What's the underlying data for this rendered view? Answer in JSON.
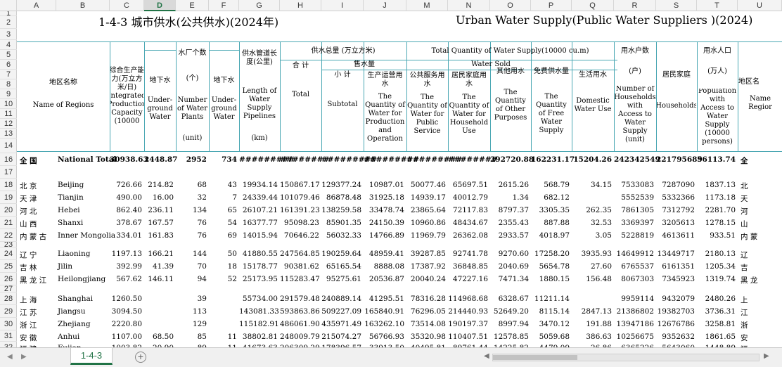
{
  "titles": {
    "cn": "1-4-3   城市供水(公共供水)(2024年)",
    "en": "Urban Water Supply(Public Water Suppliers )(2024)"
  },
  "columns": [
    "A",
    "B",
    "C",
    "D",
    "E",
    "F",
    "G",
    "H",
    "I",
    "J",
    "M",
    "N",
    "O",
    "P",
    "Q",
    "R",
    "S",
    "T",
    "U"
  ],
  "selected_column": "D",
  "rows": [
    "1",
    "2",
    "3",
    "4",
    "5",
    "6",
    "7",
    "8",
    "9",
    "10",
    "11",
    "12",
    "13",
    "14",
    "16",
    "17",
    "18",
    "19",
    "20",
    "21",
    "22",
    "23",
    "24",
    "25",
    "26",
    "27",
    "28",
    "29",
    "30",
    "31",
    "32"
  ],
  "headers": {
    "region_cn": "地区名称",
    "region_en": "Name of Regions",
    "capacity": "综合生产能力(万立方米/日) Integrated Production Capacity (10000",
    "underground_cn": "地下水",
    "underground_en": "Under-ground Water",
    "plants_cn": "水厂个数",
    "plants_unit": "(个)",
    "plants_en": "Number of Water Plants",
    "plants_unit_en": "(unit)",
    "plants_ug_cn": "地下水",
    "plants_ug_en": "Under-ground Water",
    "pipeline_cn": "供水管道长度(公里)",
    "pipeline_en": "Length of Water Supply Pipelines",
    "pipeline_unit": "(km)",
    "total_group_cn": "供水总量 (万立方米)",
    "total_group_en": "Total Quantity of Water Supply(10000 cu.m)",
    "total_cn": "合 计",
    "total_en": "Total",
    "sold_cn": "售水量",
    "sold_en": "Water Sold",
    "subtotal_cn": "小 计",
    "subtotal_en": "Subtotal",
    "production_cn": "生产运营用水",
    "production_en": "The Quantity of Water for Production and Operation",
    "public_cn": "公共服务用水",
    "public_en": "The Quantity of Water for Public Service",
    "household_cn": "居民家庭用水",
    "household_en": "The Quantity of Water for Household Use",
    "other_cn": "其他用水",
    "other_en": "The Quantity of Other Purposes",
    "free_cn": "免费供水量",
    "free_en": "The Quantity of Free Water Supply",
    "domestic_cn": "生活用水",
    "domestic_en": "Domestic Water Use",
    "hh_count_cn": "用水户数",
    "hh_count_unit": "(户)",
    "hh_count_en": "Number of Households with Access to Water Supply",
    "hh_count_unit_en": "(unit)",
    "resident_cn": "居民家庭",
    "resident_en": "Households",
    "pop_cn": "用水人口",
    "pop_unit": "(万人)",
    "pop_en": "Population with Access to Water Supply (10000 persons)",
    "region2_cn": "地区名",
    "region2_en": "Name Regior"
  },
  "data_rows": [
    {
      "row": "16",
      "cn": "全     国",
      "en": "National Total",
      "c": "30938.63",
      "d": "2448.87",
      "e": "2952",
      "f": "734",
      "g": "#########",
      "h": "########",
      "i": "#########",
      "j": "#########",
      "m": "#########",
      "n": "########",
      "o": "292720.88",
      "p": "162231.17",
      "q": "15204.26",
      "r": "242342549",
      "s": "221795689",
      "t": "56113.74",
      "u": "全",
      "bold": true
    },
    {
      "row": "18",
      "cn": "北     京",
      "en": "Beijing",
      "c": "726.66",
      "d": "214.82",
      "e": "68",
      "f": "43",
      "g": "19934.14",
      "h": "150867.17",
      "i": "129377.24",
      "j": "10987.01",
      "m": "50077.46",
      "n": "65697.51",
      "o": "2615.26",
      "p": "568.79",
      "q": "34.15",
      "r": "7533083",
      "s": "7287090",
      "t": "1837.13",
      "u": "北"
    },
    {
      "row": "19",
      "cn": "天     津",
      "en": "Tianjin",
      "c": "490.00",
      "d": "16.00",
      "e": "32",
      "f": "7",
      "g": "24339.44",
      "h": "101079.46",
      "i": "86878.48",
      "j": "31925.18",
      "m": "14939.17",
      "n": "40012.79",
      "o": "1.34",
      "p": "682.12",
      "q": "",
      "r": "5552539",
      "s": "5332366",
      "t": "1173.18",
      "u": "天"
    },
    {
      "row": "20",
      "cn": "河     北",
      "en": "Hebei",
      "c": "862.40",
      "d": "236.11",
      "e": "134",
      "f": "65",
      "g": "26107.21",
      "h": "161391.23",
      "i": "138259.58",
      "j": "33478.74",
      "m": "23865.64",
      "n": "72117.83",
      "o": "8797.37",
      "p": "3305.35",
      "q": "262.35",
      "r": "7861305",
      "s": "7312792",
      "t": "2281.70",
      "u": "河"
    },
    {
      "row": "21",
      "cn": "山     西",
      "en": "Shanxi",
      "c": "378.67",
      "d": "167.57",
      "e": "76",
      "f": "54",
      "g": "16377.77",
      "h": "95098.23",
      "i": "85901.35",
      "j": "24150.39",
      "m": "10960.86",
      "n": "48434.67",
      "o": "2355.43",
      "p": "887.88",
      "q": "32.53",
      "r": "3369397",
      "s": "3205613",
      "t": "1278.15",
      "u": "山"
    },
    {
      "row": "22",
      "cn": "内 蒙 古",
      "en": "Inner Mongolia",
      "c": "334.01",
      "d": "161.83",
      "e": "76",
      "f": "69",
      "g": "14015.94",
      "h": "70646.22",
      "i": "56032.33",
      "j": "14766.89",
      "m": "11969.79",
      "n": "26362.08",
      "o": "2933.57",
      "p": "4018.97",
      "q": "3.05",
      "r": "5228819",
      "s": "4613611",
      "t": "933.51",
      "u": "内 蒙"
    },
    {
      "row": "24",
      "cn": "辽     宁",
      "en": "Liaoning",
      "c": "1197.13",
      "d": "166.21",
      "e": "144",
      "f": "50",
      "g": "41880.55",
      "h": "247564.85",
      "i": "190259.64",
      "j": "48959.41",
      "m": "39287.85",
      "n": "92741.78",
      "o": "9270.60",
      "p": "17258.20",
      "q": "3935.93",
      "r": "14649912",
      "s": "13449717",
      "t": "2180.13",
      "u": "辽"
    },
    {
      "row": "25",
      "cn": "吉     林",
      "en": "Jilin",
      "c": "392.99",
      "d": "41.39",
      "e": "70",
      "f": "18",
      "g": "15178.77",
      "h": "90381.62",
      "i": "65165.54",
      "j": "8888.08",
      "m": "17387.92",
      "n": "36848.85",
      "o": "2040.69",
      "p": "5654.78",
      "q": "27.60",
      "r": "6765537",
      "s": "6161351",
      "t": "1205.34",
      "u": "吉"
    },
    {
      "row": "26",
      "cn": "黑 龙 江",
      "en": "Heilongjiang",
      "c": "567.62",
      "d": "146.11",
      "e": "94",
      "f": "52",
      "g": "25173.95",
      "h": "115283.47",
      "i": "95275.61",
      "j": "20536.87",
      "m": "20040.24",
      "n": "47227.16",
      "o": "7471.34",
      "p": "1880.15",
      "q": "156.48",
      "r": "8067303",
      "s": "7345923",
      "t": "1319.74",
      "u": "黑 龙"
    },
    {
      "row": "28",
      "cn": "上     海",
      "en": "Shanghai",
      "c": "1260.50",
      "d": "",
      "e": "39",
      "f": "",
      "g": "55734.00",
      "h": "291579.48",
      "i": "240889.14",
      "j": "41295.51",
      "m": "78316.28",
      "n": "114968.68",
      "o": "6328.67",
      "p": "11211.14",
      "q": "",
      "r": "9959114",
      "s": "9432079",
      "t": "2480.26",
      "u": "上"
    },
    {
      "row": "29",
      "cn": "江     苏",
      "en": "Jiangsu",
      "c": "3094.50",
      "d": "",
      "e": "113",
      "f": "",
      "g": "143081.33",
      "h": "593863.86",
      "i": "509227.09",
      "j": "165840.91",
      "m": "76296.05",
      "n": "214440.93",
      "o": "52649.20",
      "p": "8115.14",
      "q": "2847.13",
      "r": "21386802",
      "s": "19382703",
      "t": "3736.31",
      "u": "江"
    },
    {
      "row": "30",
      "cn": "浙     江",
      "en": "Zhejiang",
      "c": "2220.80",
      "d": "",
      "e": "129",
      "f": "",
      "g": "115182.91",
      "h": "486061.90",
      "i": "435971.49",
      "j": "163262.10",
      "m": "73514.08",
      "n": "190197.37",
      "o": "8997.94",
      "p": "3470.12",
      "q": "191.88",
      "r": "13947186",
      "s": "12676786",
      "t": "3258.81",
      "u": "浙"
    },
    {
      "row": "31",
      "cn": "安     徽",
      "en": "Anhui",
      "c": "1107.00",
      "d": "68.50",
      "e": "85",
      "f": "11",
      "g": "38802.81",
      "h": "248009.79",
      "i": "215074.27",
      "j": "56766.93",
      "m": "35320.98",
      "n": "110407.51",
      "o": "12578.85",
      "p": "5059.68",
      "q": "386.63",
      "r": "10256675",
      "s": "9352632",
      "t": "1861.65",
      "u": "安"
    },
    {
      "row": "32",
      "cn": "福     建",
      "en": "Fujian",
      "c": "1003.82",
      "d": "20.90",
      "e": "89",
      "f": "11",
      "g": "41673.63",
      "h": "206309.29",
      "i": "178396.57",
      "j": "33913.50",
      "m": "40495.81",
      "n": "89761.44",
      "o": "14225.82",
      "p": "4479.09",
      "q": "26.86",
      "r": "6365226",
      "s": "5643060",
      "t": "1448.89",
      "u": "福"
    }
  ],
  "tab": {
    "label": "1-4-3",
    "add": "+"
  },
  "nav": {
    "prev": "◀",
    "next": "▶"
  },
  "colors": {
    "accent": "#217346",
    "header_border": "#4aa7b3"
  }
}
